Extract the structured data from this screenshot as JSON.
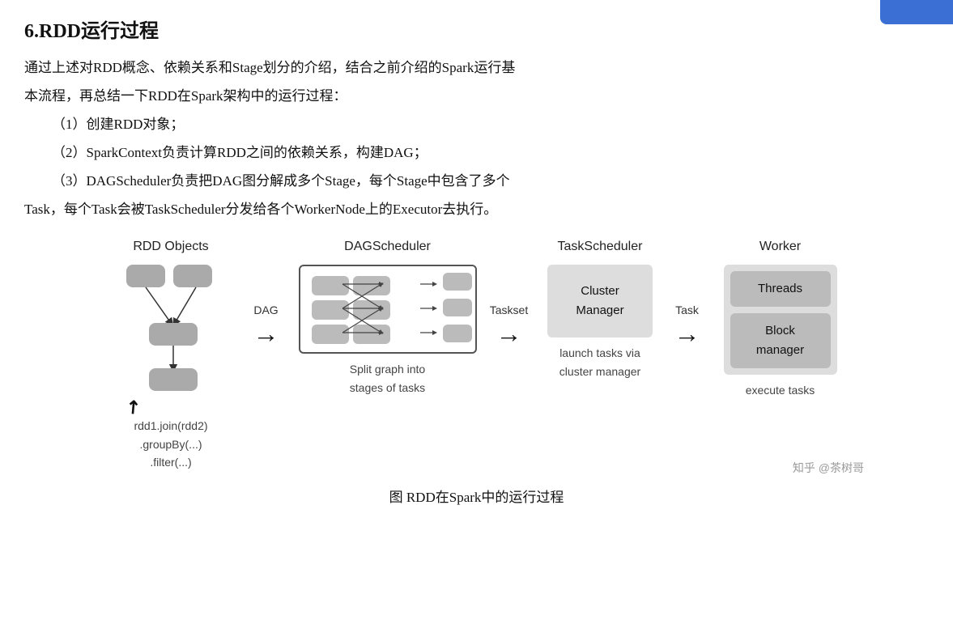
{
  "title": "6.RDD运行过程",
  "intro_lines": [
    "通过上述对RDD概念、依赖关系和Stage划分的介绍，结合之前介绍的Spark运行基",
    "本流程，再总结一下RDD在Spark架构中的运行过程：",
    "（1）创建RDD对象；",
    "（2）SparkContext负责计算RDD之间的依赖关系，构建DAG；",
    "（3）DAGScheduler负责把DAG图分解成多个Stage，每个Stage中包含了多个",
    "Task，每个Task会被TaskScheduler分发给各个WorkerNode上的Executor去执行。"
  ],
  "diagram": {
    "col1_label": "RDD Objects",
    "col1_sub": "rdd1.join(rdd2)\n.groupBy(...)\n.filter(...)",
    "arrow1_label": "DAG",
    "col2_label": "DAGScheduler",
    "col2_sub": "Split graph into\nstages of tasks",
    "arrow2_label": "Taskset",
    "col3_label": "TaskScheduler",
    "col3_sub": "launch tasks via\ncluster manager",
    "col3_inner": "Cluster\nManager",
    "arrow3_label": "Task",
    "col4_label": "Worker",
    "col4_sub": "execute tasks",
    "worker_box1": "Threads",
    "worker_box2": "Block\nmanager"
  },
  "caption": "图 RDD在Spark中的运行过程",
  "credit": "知乎 @茶树哥"
}
